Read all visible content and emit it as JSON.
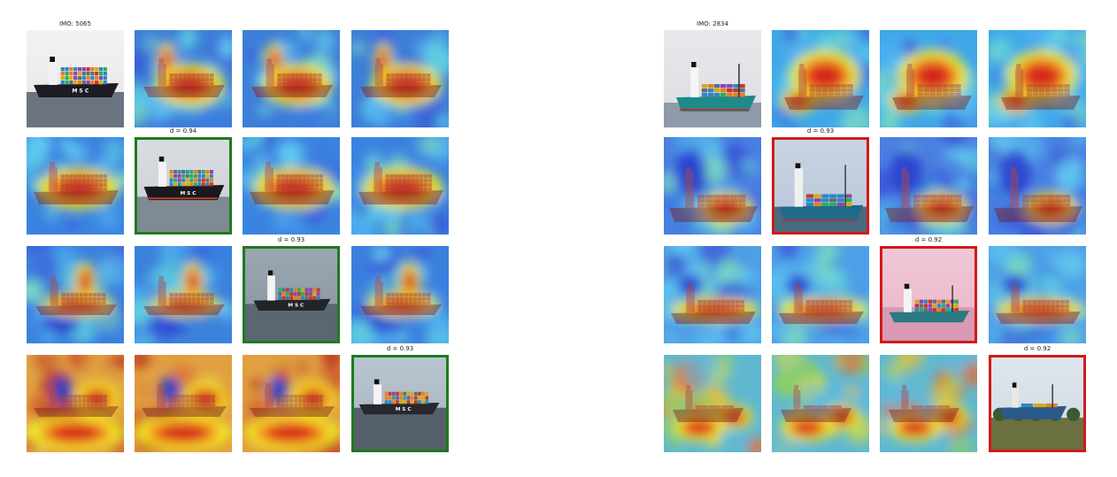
{
  "colors": {
    "match_border": "#1f7a1f",
    "mismatch_border": "#d11a1a",
    "background": "#ffffff"
  },
  "left_panel": {
    "query_label": "IMO: 5065",
    "diagonal_labels": [
      "d = 0.94",
      "d = 0.93",
      "d = 0.93"
    ],
    "border": "match",
    "ship_text": "M S C"
  },
  "right_panel": {
    "query_label": "IMO: 2834",
    "diagonal_labels": [
      "d = 0.93",
      "d = 0.92",
      "d = 0.92"
    ],
    "border": "mismatch"
  }
}
